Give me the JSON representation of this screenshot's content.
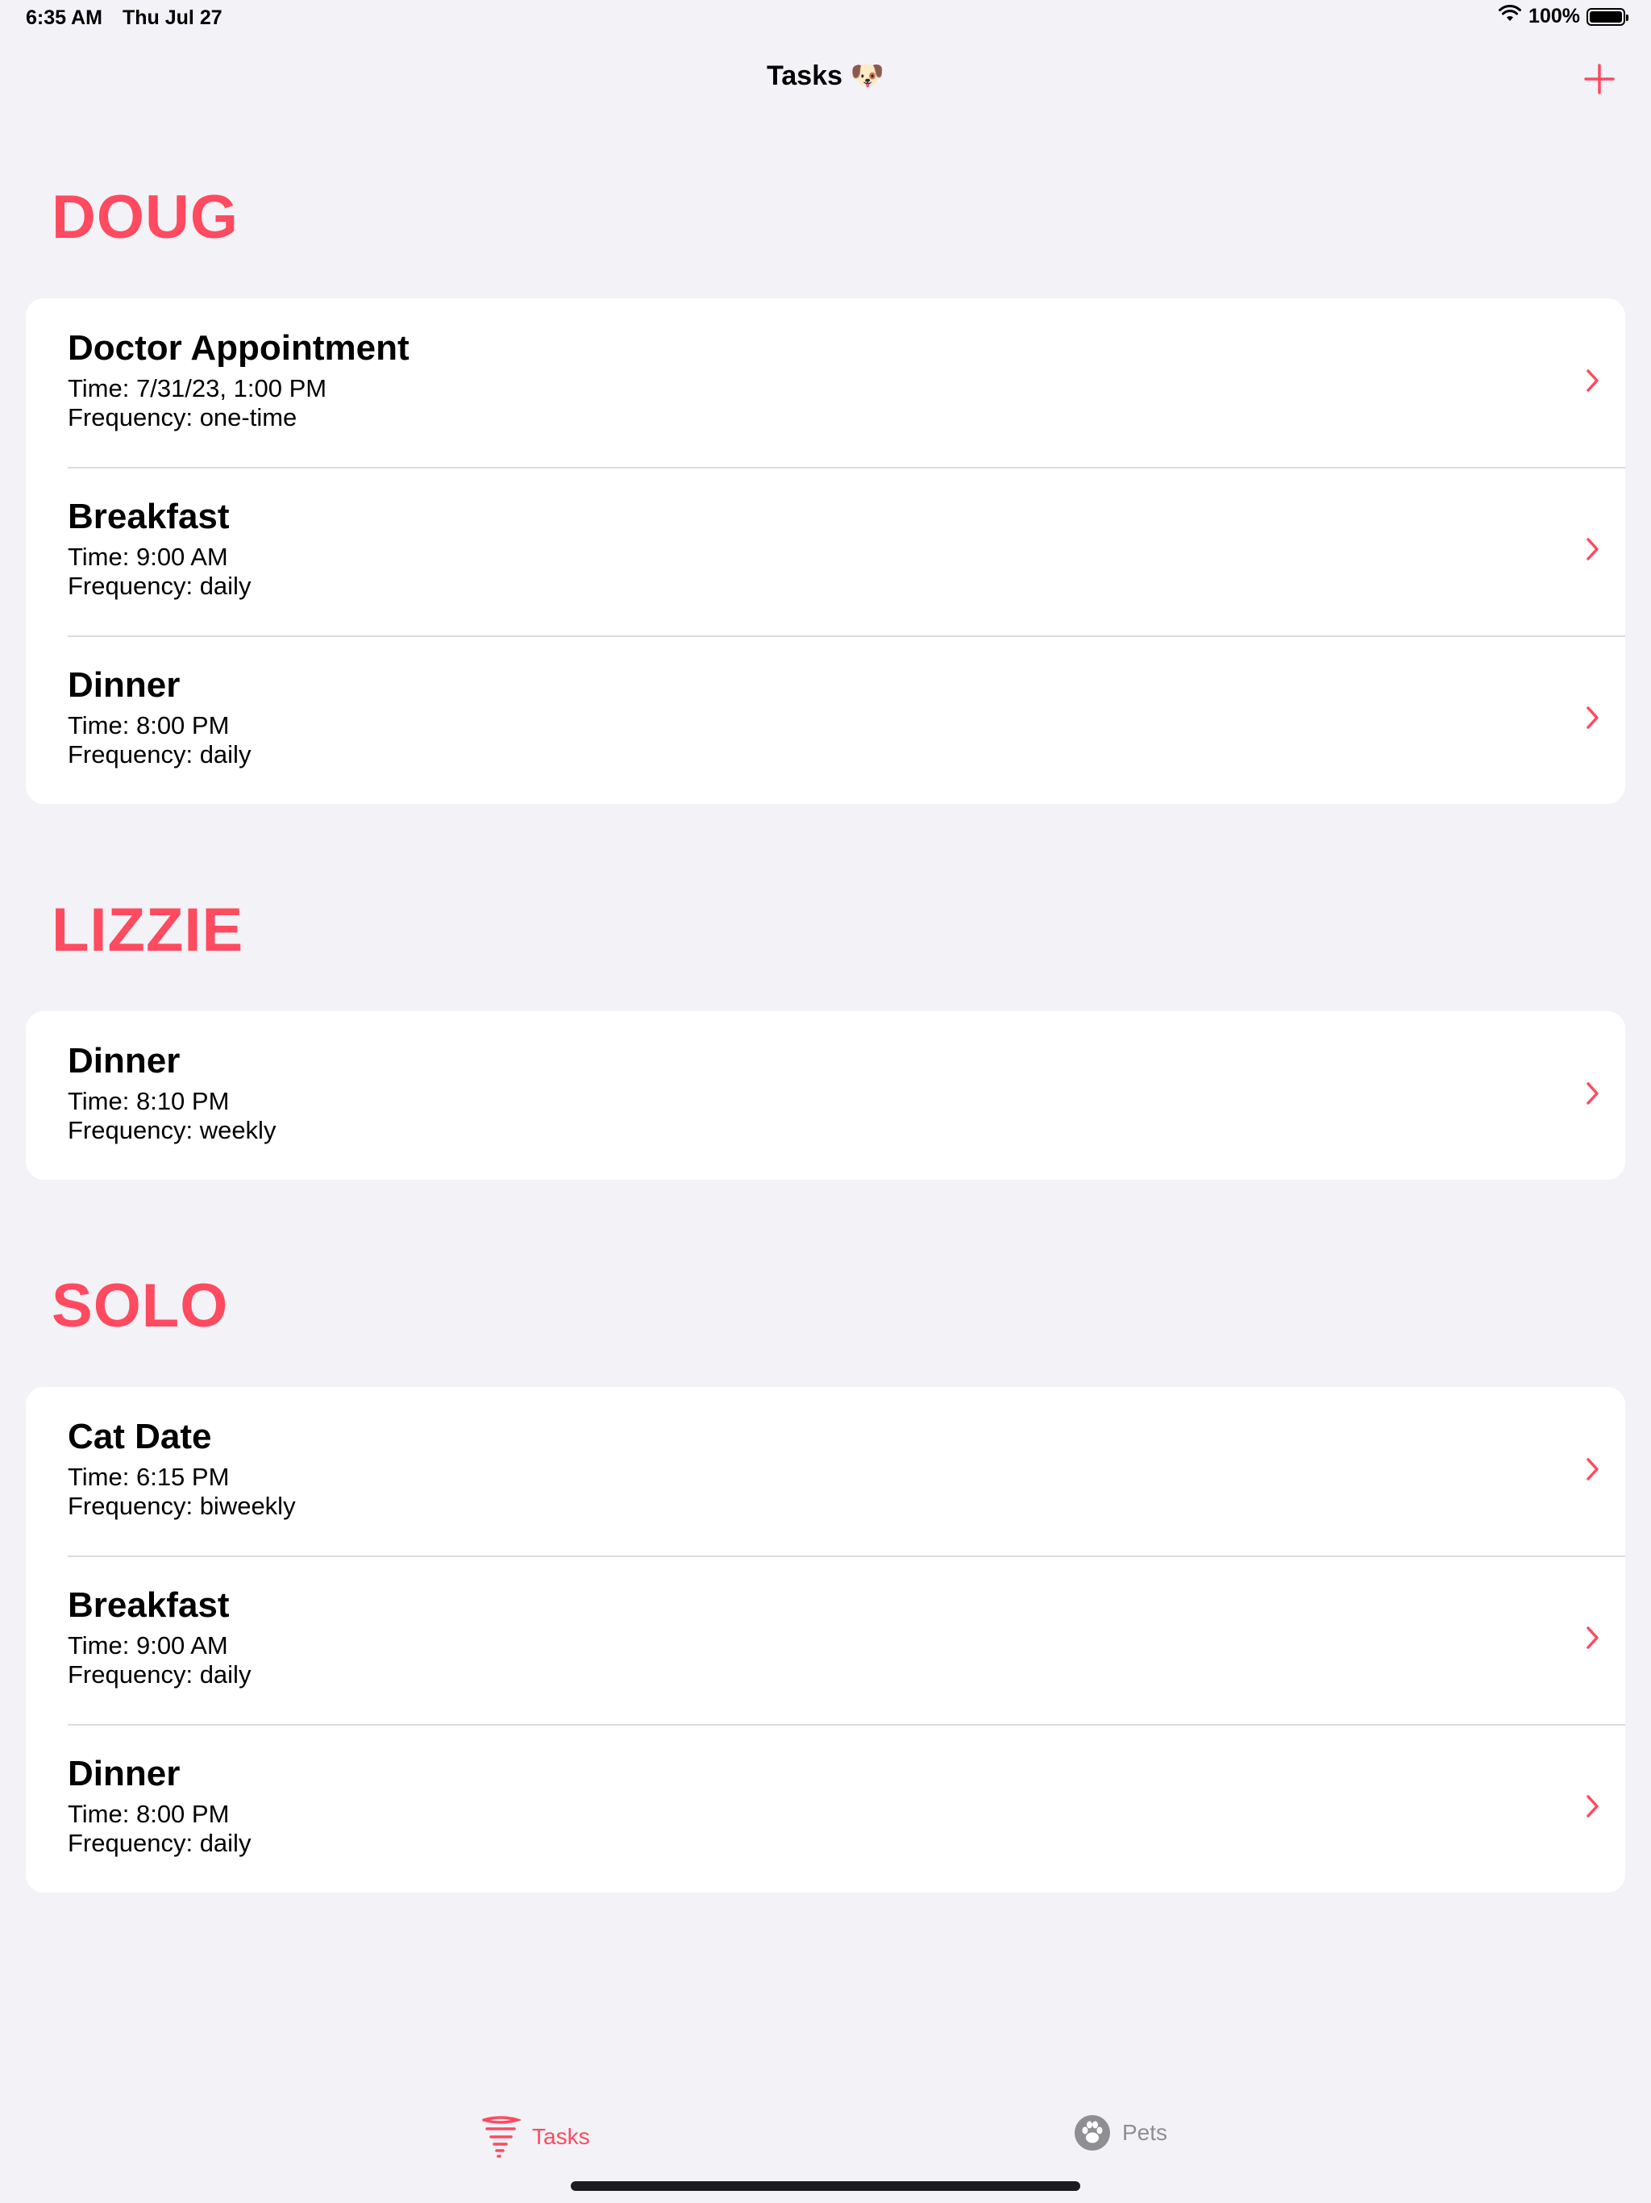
{
  "status_bar": {
    "time": "6:35 AM",
    "date": "Thu Jul 27",
    "battery": "100%"
  },
  "nav": {
    "title": "Tasks 🐶"
  },
  "sections": [
    {
      "name": "DOUG",
      "tasks": [
        {
          "title": "Doctor Appointment",
          "time": "Time: 7/31/23, 1:00 PM",
          "frequency": "Frequency: one-time"
        },
        {
          "title": "Breakfast",
          "time": "Time: 9:00 AM",
          "frequency": "Frequency: daily"
        },
        {
          "title": "Dinner",
          "time": "Time: 8:00 PM",
          "frequency": "Frequency: daily"
        }
      ]
    },
    {
      "name": "LIZZIE",
      "tasks": [
        {
          "title": "Dinner",
          "time": "Time: 8:10 PM",
          "frequency": "Frequency: weekly"
        }
      ]
    },
    {
      "name": "SOLO",
      "tasks": [
        {
          "title": "Cat Date",
          "time": "Time: 6:15 PM",
          "frequency": "Frequency: biweekly"
        },
        {
          "title": "Breakfast",
          "time": "Time: 9:00 AM",
          "frequency": "Frequency: daily"
        },
        {
          "title": "Dinner",
          "time": "Time: 8:00 PM",
          "frequency": "Frequency: daily"
        }
      ]
    }
  ],
  "tab_bar": {
    "tasks_label": "Tasks",
    "pets_label": "Pets"
  },
  "colors": {
    "accent": "#ff4a5f",
    "background": "#f2f2f7",
    "inactive_tab": "#8e8e93"
  }
}
